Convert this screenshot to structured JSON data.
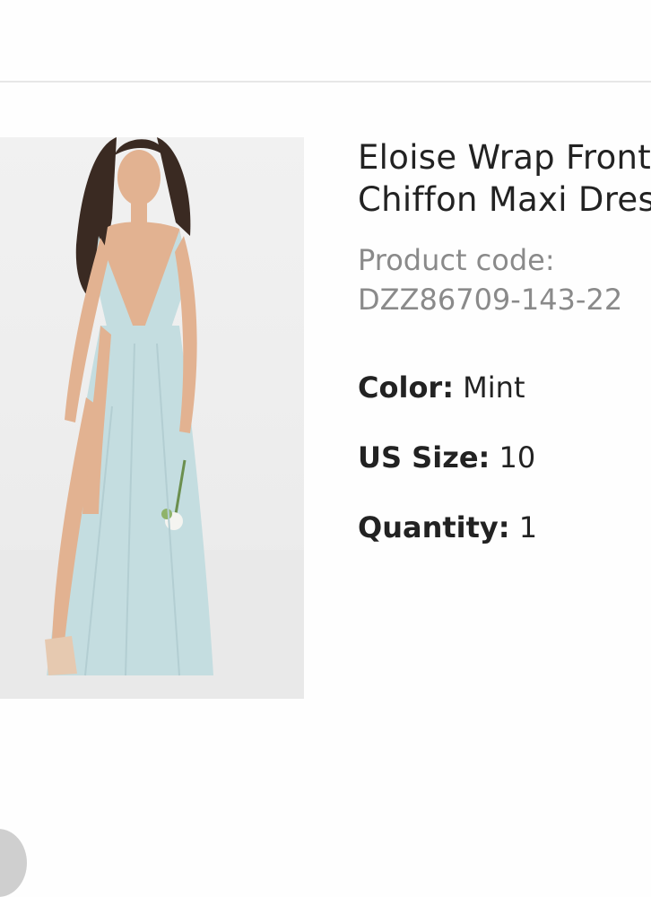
{
  "product": {
    "title_line1": "Eloise Wrap Front",
    "title_line2": "Chiffon Maxi Dress",
    "code_label": "Product code:",
    "code_value": "DZZ86709-143-22",
    "image_alt": "Model wearing mint chiffon maxi dress"
  },
  "attributes": {
    "color_label": "Color:",
    "color_value": "Mint",
    "size_label": "US Size:",
    "size_value": "10",
    "quantity_label": "Quantity:",
    "quantity_value": "1"
  },
  "colors": {
    "dress": "#c4dde0",
    "background": "#efefef",
    "skin": "#e2b291",
    "hair": "#3a2a22"
  },
  "icons": {
    "floating_button": "circle-button-icon"
  }
}
